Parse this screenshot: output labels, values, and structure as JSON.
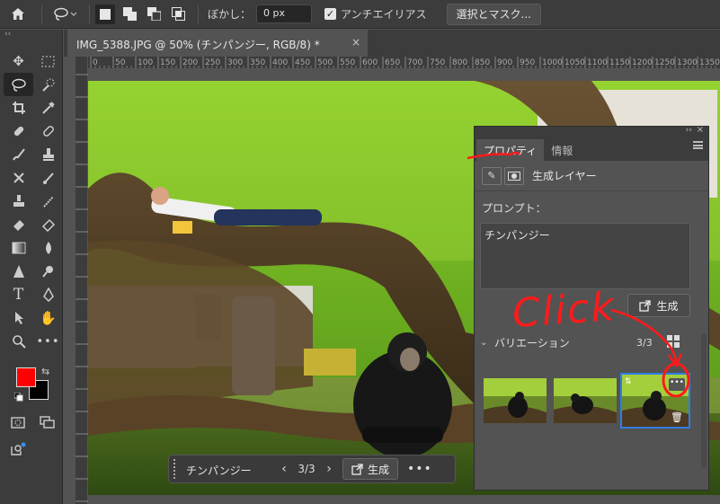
{
  "options_bar": {
    "feather_label": "ぼかし：",
    "feather_value": "0 px",
    "antialias_label": "アンチエイリアス",
    "select_mask_label": "選択とマスク..."
  },
  "document": {
    "tab_title": "IMG_5388.JPG @ 50% (チンパンジー, RGB/8) *"
  },
  "ruler": {
    "marks": [
      "0",
      "50",
      "100",
      "150",
      "200",
      "250",
      "300",
      "350",
      "400",
      "450",
      "500",
      "550",
      "600",
      "650",
      "700",
      "750",
      "800",
      "850",
      "900",
      "950",
      "1000",
      "1050",
      "1100",
      "1150",
      "1200",
      "1250",
      "1300",
      "1350"
    ]
  },
  "context_bar": {
    "prompt": "チンパンジー",
    "counter": "3/3",
    "generate_label": "生成"
  },
  "properties": {
    "tab_properties": "プロパティ",
    "tab_info": "情報",
    "layer_type": "生成レイヤー",
    "prompt_label": "プロンプト：",
    "prompt_value": "チンパンジー",
    "generate_label": "生成",
    "variations_label": "バリエーション",
    "variations_count": "3/3"
  },
  "annotation": {
    "text": "Click",
    "color": "#ff1a1a"
  },
  "colors": {
    "foreground": "#ff0000",
    "background": "#000000",
    "accent": "#2f7ee6"
  }
}
